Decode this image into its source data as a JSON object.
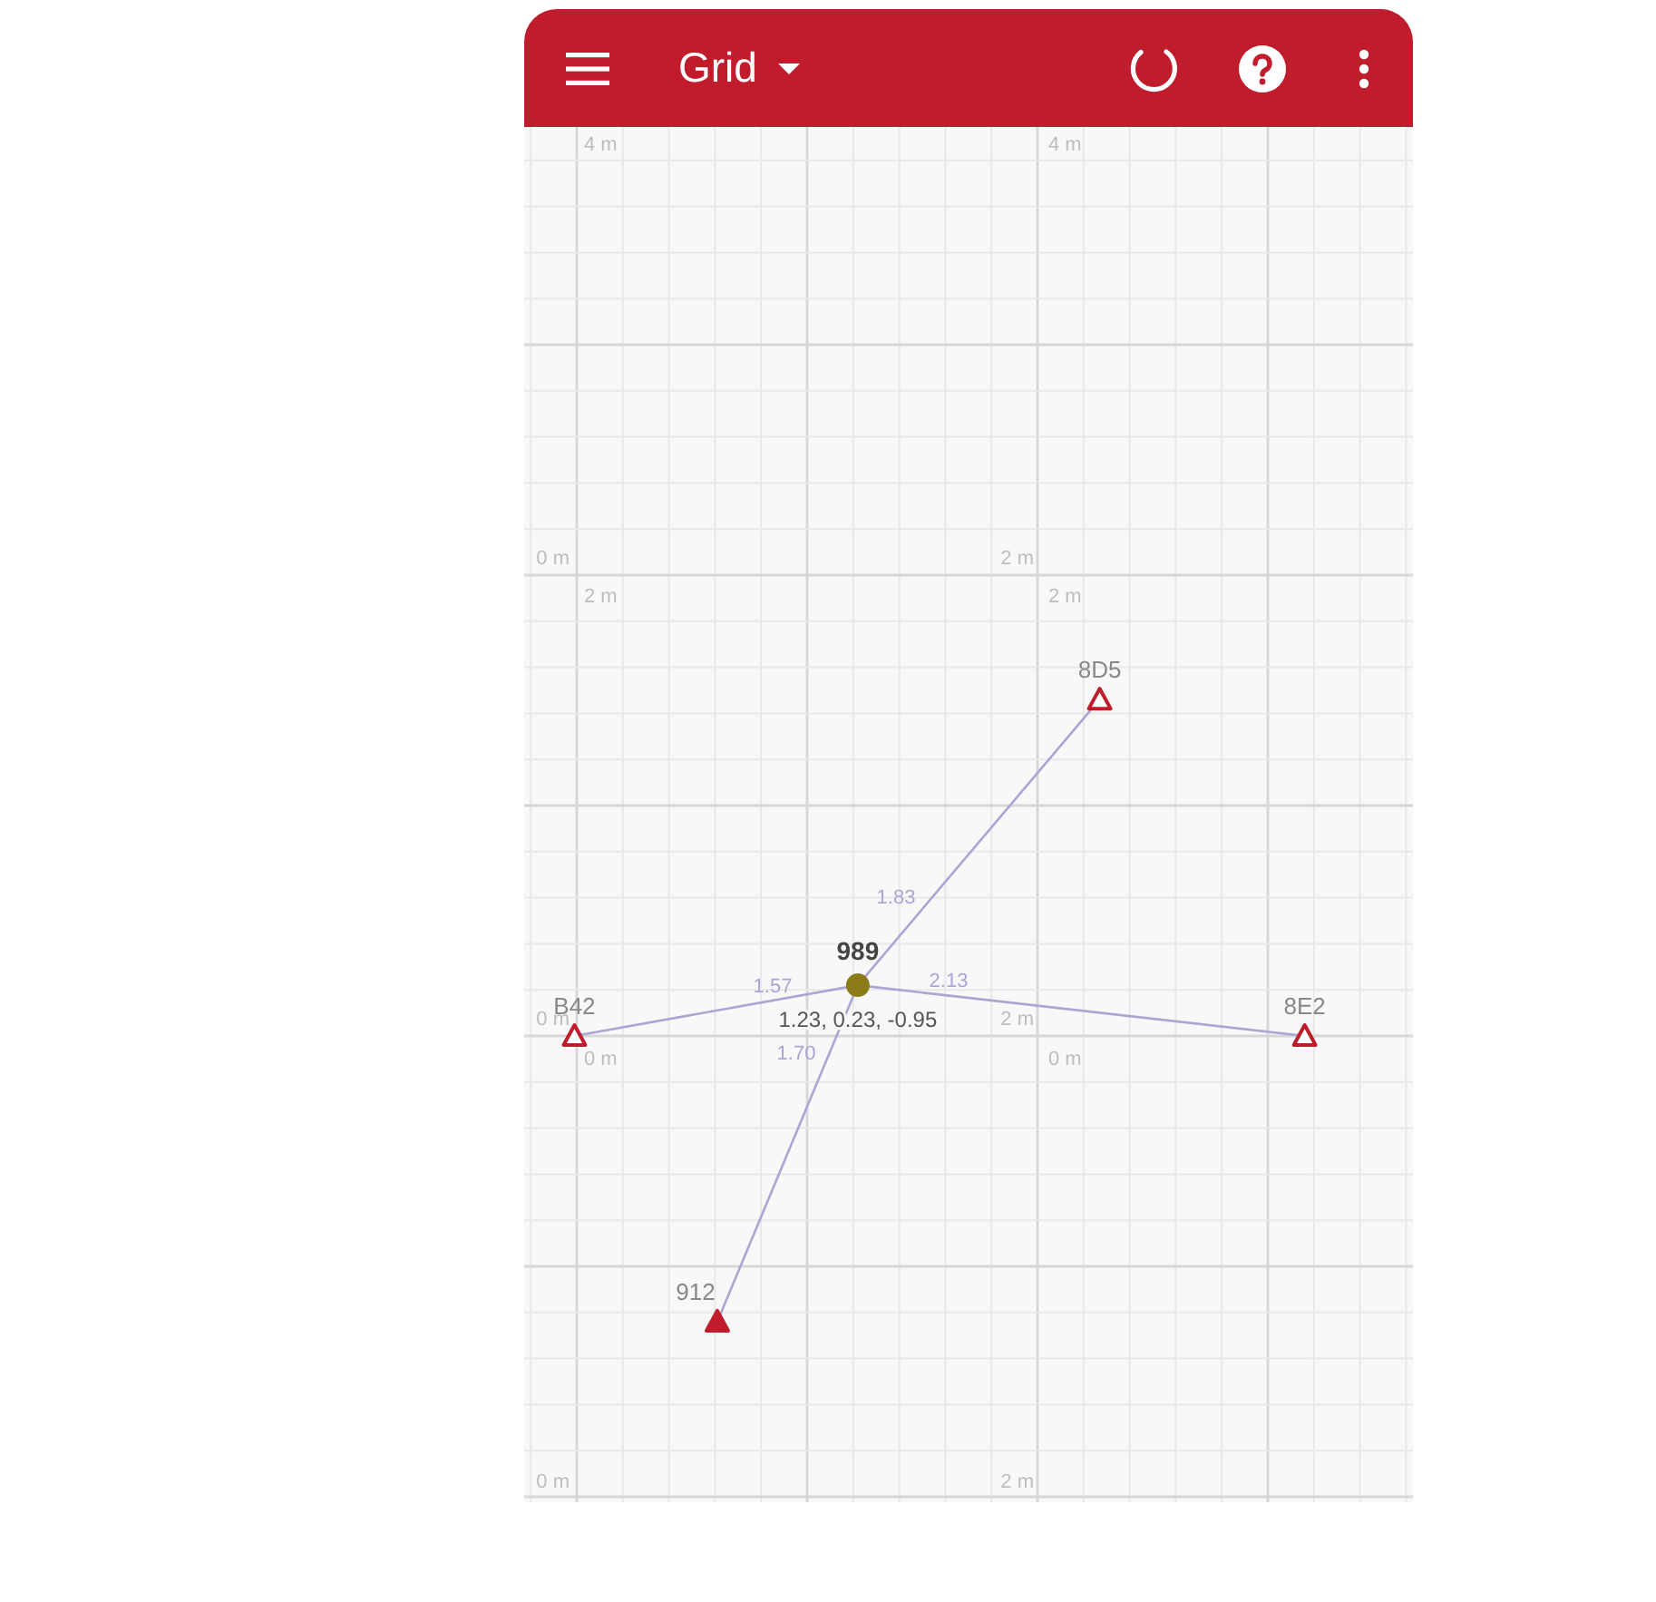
{
  "app_bar": {
    "title": "Grid"
  },
  "grid_labels": [
    "4 m",
    "4 m",
    "0 m",
    "2 m",
    "2 m",
    "2 m",
    "0 m",
    "2 m",
    "0 m",
    "0 m",
    "0 m",
    "2 m"
  ],
  "tag": {
    "name": "989",
    "position": "1.23, 0.23, -0.95"
  },
  "anchors": [
    {
      "name": "8D5",
      "distance": "1.83",
      "filled": false
    },
    {
      "name": "B42",
      "distance": "1.57",
      "filled": false
    },
    {
      "name": "8E2",
      "distance": "2.13",
      "filled": false
    },
    {
      "name": "912",
      "distance": "1.70",
      "filled": true
    }
  ]
}
